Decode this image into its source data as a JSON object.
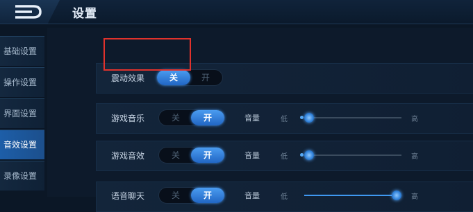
{
  "header": {
    "title": "设置"
  },
  "sidebar": {
    "items": [
      {
        "label": "基础设置",
        "active": false
      },
      {
        "label": "操作设置",
        "active": false
      },
      {
        "label": "界面设置",
        "active": false
      },
      {
        "label": "音效设置",
        "active": true
      },
      {
        "label": "录像设置",
        "active": false
      }
    ]
  },
  "settings": {
    "vibration": {
      "label": "震动效果",
      "off_label": "关",
      "on_label": "开",
      "selected": "off"
    },
    "music": {
      "label": "游戏音乐",
      "off_label": "关",
      "on_label": "开",
      "selected": "on",
      "volume_label": "音量",
      "low_label": "低",
      "high_label": "高",
      "volume": 0.05
    },
    "sfx": {
      "label": "游戏音效",
      "off_label": "关",
      "on_label": "开",
      "selected": "on",
      "volume_label": "音量",
      "low_label": "低",
      "high_label": "高",
      "volume": 0.05
    },
    "voice": {
      "label": "语音聊天",
      "off_label": "关",
      "on_label": "开",
      "selected": "on",
      "volume_label": "音量",
      "low_label": "低",
      "high_label": "高",
      "volume": 0.95
    }
  },
  "colors": {
    "accent": "#2f7fdc",
    "highlight_box": "#e0322c"
  }
}
